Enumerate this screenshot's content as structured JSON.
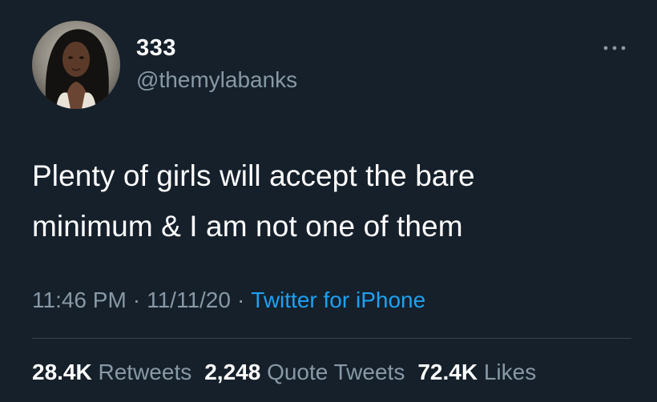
{
  "tweet": {
    "author": {
      "display_name": "333",
      "handle": "@themylabanks",
      "avatar_icon": "profile-photo"
    },
    "more_icon": "more-horizontal-icon",
    "text_lines": [
      "Plenty of girls will accept the bare",
      "minimum & I am not one of them"
    ],
    "time": "11:46 PM",
    "separator": "·",
    "date": "11/11/20",
    "source": "Twitter for iPhone",
    "stats": {
      "retweets_count": "28.4K",
      "retweets_label": "Retweets",
      "quote_tweets_count": "2,248",
      "quote_tweets_label": "Quote Tweets",
      "likes_count": "72.4K",
      "likes_label": "Likes"
    }
  },
  "colors": {
    "background": "#15202b",
    "primary_text": "#ffffff",
    "secondary_text": "#8899a6",
    "link": "#1da1f2",
    "divider": "#38444d"
  }
}
